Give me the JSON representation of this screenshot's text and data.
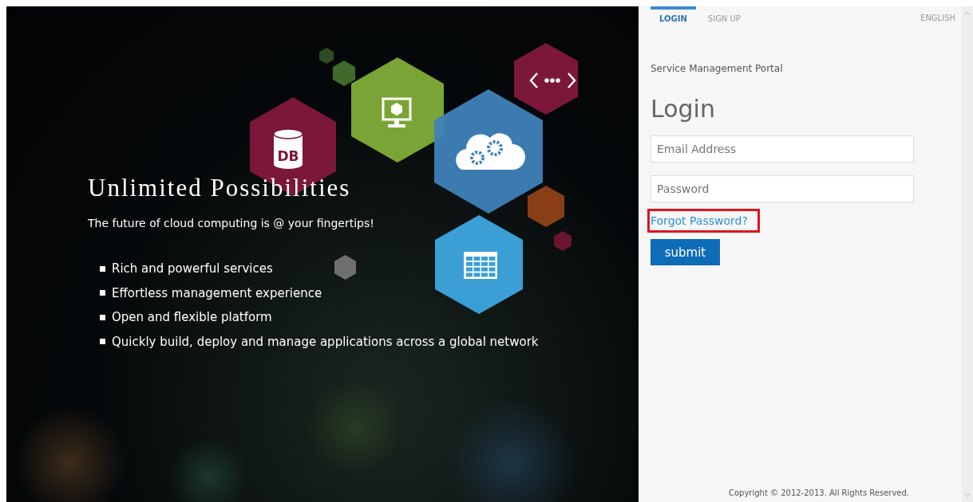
{
  "hero": {
    "db_label": "DB",
    "title": "Unlimited Possibilities",
    "subtitle": "The future of cloud computing is @ your fingertips!",
    "features": [
      "Rich and powerful services",
      "Effortless management experience",
      "Open and flexible platform",
      "Quickly build, deploy and manage applications across a global network"
    ]
  },
  "tabs": [
    {
      "label": "LOGIN",
      "selected": true
    },
    {
      "label": "SIGN UP",
      "selected": false
    }
  ],
  "language": "ENGLISH",
  "portal_name": "Service Management Portal",
  "form": {
    "heading": "Login",
    "email": {
      "placeholder": "Email Address"
    },
    "password": {
      "placeholder": "Password"
    },
    "forgot_link": {
      "label": "Forgot Password?",
      "highlighted": true
    },
    "submit": "submit"
  },
  "copyright": "Copyright © 2012-2013. All Rights Reserved."
}
